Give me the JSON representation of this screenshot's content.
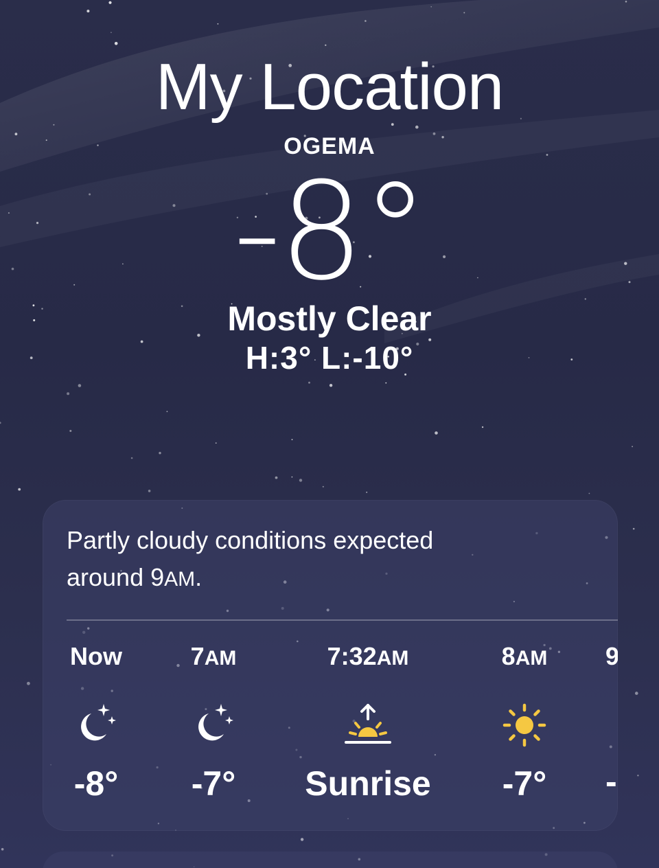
{
  "header": {
    "title": "My Location",
    "place": "OGEMA",
    "temperature": "-8°",
    "condition": "Mostly Clear",
    "high_low": "H:3°  L:-10°"
  },
  "hourly_card": {
    "summary_line1": "Partly cloudy conditions expected",
    "summary_line2_prefix": "around 9",
    "summary_line2_suffix": "AM",
    "summary_line2_end": ".",
    "items": [
      {
        "time": "Now",
        "time_suffix": "",
        "icon": "moon-stars-icon",
        "value": "-8°"
      },
      {
        "time": "7",
        "time_suffix": "AM",
        "icon": "moon-stars-icon",
        "value": "-7°"
      },
      {
        "time": "7:32",
        "time_suffix": "AM",
        "icon": "sunrise-icon",
        "value": "Sunrise"
      },
      {
        "time": "8",
        "time_suffix": "AM",
        "icon": "sun-icon",
        "value": "-7°"
      },
      {
        "time": "9",
        "time_suffix": "",
        "icon": "sun-icon",
        "value": "-"
      }
    ]
  },
  "colors": {
    "background": "#2a2d4a",
    "card": "#3c4068",
    "sun": "#f5c842",
    "text": "#ffffff"
  }
}
